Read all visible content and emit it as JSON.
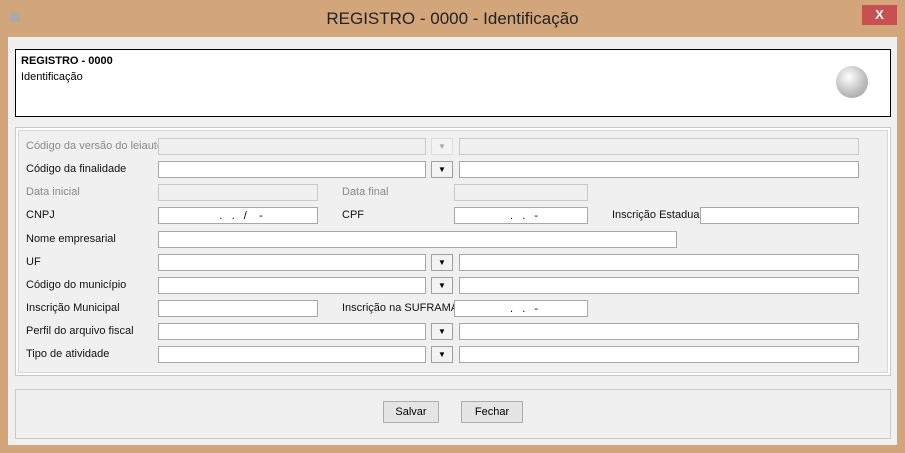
{
  "window": {
    "title": "REGISTRO - 0000 - Identificação",
    "close_label": "X"
  },
  "header": {
    "title": "REGISTRO - 0000",
    "subtitle": "Identificação"
  },
  "form": {
    "versao_label": "Código da versão do leiaute",
    "finalidade_label": "Código da finalidade",
    "data_inicial_label": "Data inicial",
    "data_final_label": "Data final",
    "cnpj_label": "CNPJ",
    "cnpj_mask": "  .   .   /    -",
    "cpf_label": "CPF",
    "cpf_mask": "  .   .   -",
    "ie_label": "Inscrição Estadual",
    "nome_label": "Nome empresarial",
    "uf_label": "UF",
    "municipio_label": "Código do município",
    "im_label": "Inscrição Municipal",
    "suframa_label": "Inscrição na SUFRAMA",
    "suframa_mask": "  .   .   -",
    "perfil_label": "Perfil do arquivo fiscal",
    "atividade_label": "Tipo de atividade"
  },
  "buttons": {
    "save": "Salvar",
    "close": "Fechar"
  }
}
